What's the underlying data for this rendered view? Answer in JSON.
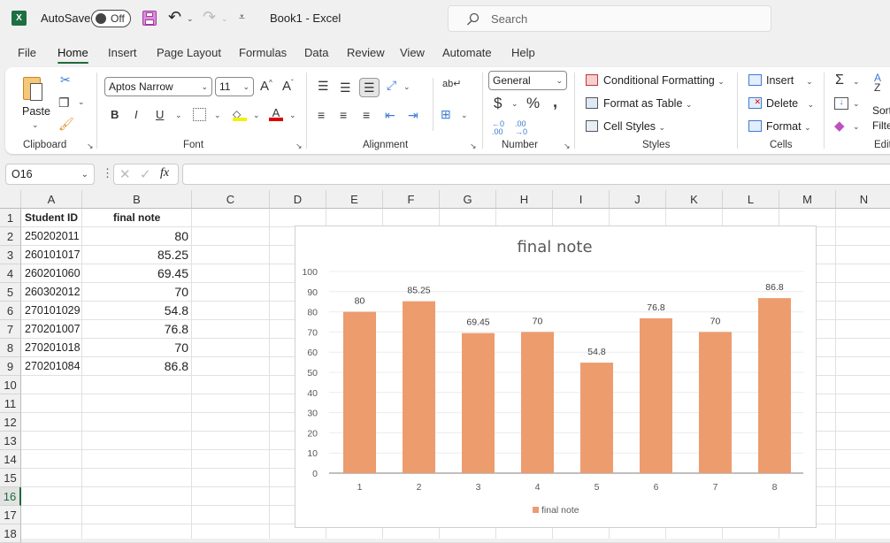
{
  "titlebar": {
    "app_icon": "excel-icon",
    "autosave_label": "AutoSave",
    "autosave_state": "Off",
    "save_icon": "save-icon",
    "undo_icon": "undo-icon",
    "redo_icon": "redo-icon",
    "customize_icon": "customize-qat-icon",
    "title": "Book1  -  Excel",
    "search_placeholder": "Search"
  },
  "menu": [
    "File",
    "Home",
    "Insert",
    "Page Layout",
    "Formulas",
    "Data",
    "Review",
    "View",
    "Automate",
    "Help"
  ],
  "active_menu": "Home",
  "ribbon": {
    "clipboard": {
      "label": "Clipboard",
      "paste": "Paste"
    },
    "font": {
      "label": "Font",
      "font_name": "Aptos Narrow",
      "font_size": "11",
      "bold": "B",
      "italic": "I",
      "underline": "U",
      "grow": "A^",
      "shrink": "Aˇ"
    },
    "alignment": {
      "label": "Alignment"
    },
    "number": {
      "label": "Number",
      "format": "General",
      "currency": "$",
      "percent": "%",
      "comma": "❟",
      "inc_decimal": "←0 .00",
      "dec_decimal": ".00 →0"
    },
    "styles": {
      "label": "Styles",
      "conditional": "Conditional Formatting",
      "format_table": "Format as Table",
      "cell_styles": "Cell Styles"
    },
    "cells": {
      "label": "Cells",
      "insert": "Insert",
      "delete": "Delete",
      "format": "Format"
    },
    "editing": {
      "label": "Edit",
      "sort": "Sort",
      "filter": "Filte"
    }
  },
  "formula_bar": {
    "name_box": "O16",
    "cancel": "✕",
    "enter": "✓",
    "fx": "fx",
    "formula": ""
  },
  "columns": [
    "A",
    "B",
    "C",
    "D",
    "E",
    "F",
    "G",
    "H",
    "I",
    "J",
    "K",
    "L",
    "M",
    "N"
  ],
  "rows": [
    "1",
    "2",
    "3",
    "4",
    "5",
    "6",
    "7",
    "8",
    "9",
    "10",
    "11",
    "12",
    "13",
    "14",
    "15",
    "16",
    "17",
    "18"
  ],
  "selected_row": "16",
  "sheet": {
    "header": [
      "Student ID",
      "final note"
    ],
    "data": [
      [
        "250202011",
        "80"
      ],
      [
        "260101017",
        "85.25"
      ],
      [
        "260201060",
        "69.45"
      ],
      [
        "260302012",
        "70"
      ],
      [
        "270101029",
        "54.8"
      ],
      [
        "270201007",
        "76.8"
      ],
      [
        "270201018",
        "70"
      ],
      [
        "270201084",
        "86.8"
      ]
    ]
  },
  "chart_data": {
    "type": "bar",
    "title": "final note",
    "categories": [
      "1",
      "2",
      "3",
      "4",
      "5",
      "6",
      "7",
      "8"
    ],
    "series": [
      {
        "name": "final note",
        "values": [
          80,
          85.25,
          69.45,
          70,
          54.8,
          76.8,
          70,
          86.8
        ],
        "color": "#ed9c6e"
      }
    ],
    "data_labels": [
      "80",
      "85.25",
      "69.45",
      "70",
      "54.8",
      "76.8",
      "70",
      "86.8"
    ],
    "xlabel": "",
    "ylabel": "",
    "ylim": [
      0,
      100
    ],
    "yticks": [
      "0",
      "10",
      "20",
      "30",
      "40",
      "50",
      "60",
      "70",
      "80",
      "90",
      "100"
    ],
    "grid": true,
    "legend": "bottom"
  }
}
